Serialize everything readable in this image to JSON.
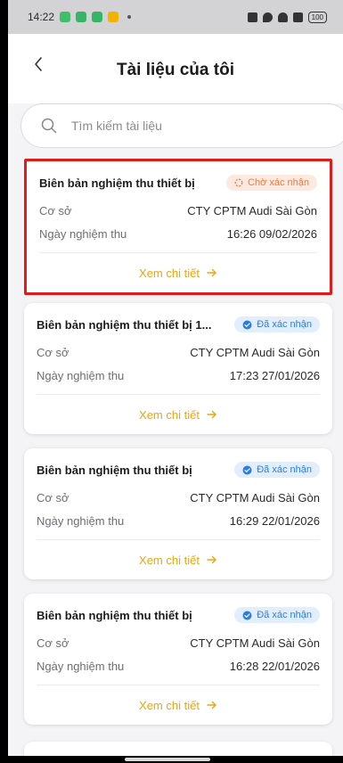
{
  "status_bar": {
    "time": "14:22",
    "battery": "100"
  },
  "header": {
    "title": "Tài liệu của tôi"
  },
  "search": {
    "placeholder": "Tìm kiếm tài liệu"
  },
  "labels": {
    "facility": "Cơ sở",
    "acceptance_date": "Ngày nghiệm thu",
    "view_detail": "Xem chi tiết"
  },
  "documents": [
    {
      "title": "Biên bản nghiệm thu thiết bị",
      "status": "Chờ xác nhận",
      "facility": "CTY CPTM Audi Sài Gòn",
      "date": "16:26 09/02/2026"
    },
    {
      "title": "Biên bản nghiệm thu thiết bị 1...",
      "status": "Đã xác nhận",
      "facility": "CTY CPTM Audi Sài Gòn",
      "date": "17:23 27/01/2026"
    },
    {
      "title": "Biên bản nghiệm thu thiết bị",
      "status": "Đã xác nhận",
      "facility": "CTY CPTM Audi Sài Gòn",
      "date": "16:29 22/01/2026"
    },
    {
      "title": "Biên bản nghiệm thu thiết bị",
      "status": "Đã xác nhận",
      "facility": "CTY CPTM Audi Sài Gòn",
      "date": "16:28 22/01/2026"
    }
  ],
  "colors": {
    "accent": "#f0a40b",
    "pending": "#f27a3a",
    "confirmed": "#2b7de0",
    "highlight": "#e11a1a"
  }
}
